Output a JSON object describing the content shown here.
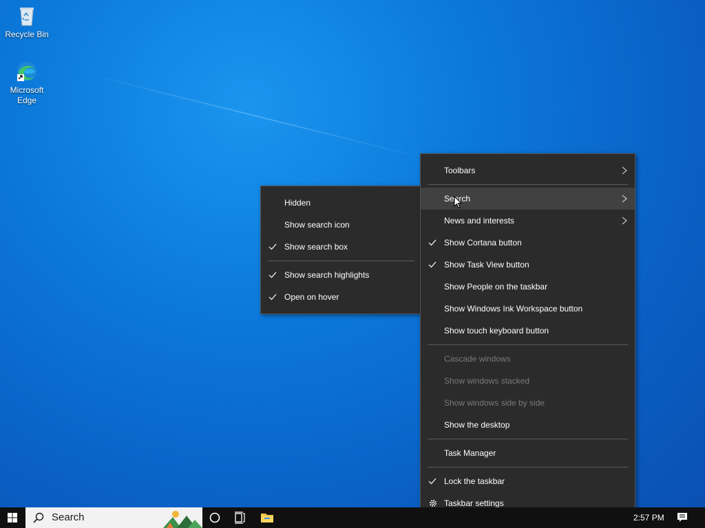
{
  "desktop": {
    "icons": [
      {
        "label": "Recycle Bin"
      },
      {
        "label": "Microsoft Edge"
      }
    ]
  },
  "context_menu": {
    "items": [
      {
        "label": "Toolbars"
      },
      {
        "label": "Search"
      },
      {
        "label": "News and interests"
      },
      {
        "label": "Show Cortana button"
      },
      {
        "label": "Show Task View button"
      },
      {
        "label": "Show People on the taskbar"
      },
      {
        "label": "Show Windows Ink Workspace button"
      },
      {
        "label": "Show touch keyboard button"
      },
      {
        "label": "Cascade windows"
      },
      {
        "label": "Show windows stacked"
      },
      {
        "label": "Show windows side by side"
      },
      {
        "label": "Show the desktop"
      },
      {
        "label": "Task Manager"
      },
      {
        "label": "Lock the taskbar"
      },
      {
        "label": "Taskbar settings"
      }
    ]
  },
  "search_submenu": {
    "items": [
      {
        "label": "Hidden"
      },
      {
        "label": "Show search icon"
      },
      {
        "label": "Show search box"
      },
      {
        "label": "Show search highlights"
      },
      {
        "label": "Open on hover"
      }
    ]
  },
  "taskbar": {
    "search_label": "Search",
    "clock": "2:57 PM"
  },
  "colors": {
    "menu_bg": "#2b2b2b",
    "menu_highlight": "#414141",
    "disabled_text": "#7a7a7a",
    "taskbar_bg": "#101010"
  }
}
